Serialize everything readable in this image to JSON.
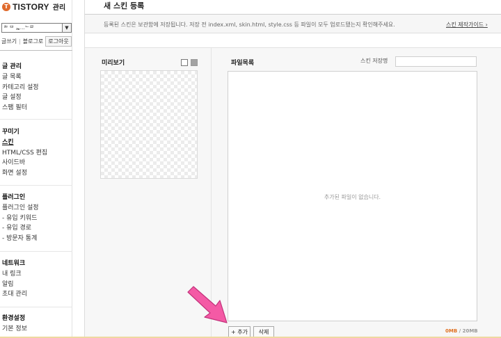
{
  "sidebar": {
    "logo_mark": "T",
    "logo_text": "TISTORY",
    "logo_sub": "관리",
    "blog_select_value": "ᄅᄇ ᄇ ᆲ…ᄂᄅ",
    "top_links": {
      "write": "글쓰기",
      "blog": "블로그로",
      "logout": "로그아웃"
    },
    "groups": [
      {
        "title": "글 관리",
        "items": [
          "글 목록",
          "카테고리 설정",
          "글 설정",
          "스팸 필터"
        ]
      },
      {
        "title": "꾸미기",
        "items": [
          "스킨",
          "HTML/CSS 편집",
          "사이드바",
          "화면 설정"
        ]
      },
      {
        "title": "플러그인",
        "items": [
          "플러그인 설정",
          "- 유입 키워드",
          "- 유입 경로",
          "- 방문자 통계"
        ]
      },
      {
        "title": "네트워크",
        "items": [
          "내 링크",
          "알림",
          "초대 관리"
        ]
      },
      {
        "title": "환경설정",
        "items": [
          "기본 정보"
        ]
      }
    ]
  },
  "header": {
    "title": "새 스킨 등록",
    "notice": "등록된 스킨은 보관함에 저장됩니다. 저장 전 index.xml, skin.html, style.css 등 파일이 모두 업로드됐는지 확인해주세요.",
    "guide_link": "스킨 제작가이드 ›"
  },
  "preview": {
    "label": "미리보기"
  },
  "files": {
    "label": "파일목록",
    "skin_name_label": "스킨 저장명",
    "skin_name_value": "",
    "empty_message": "추가된 파일이 없습니다.",
    "add_button": "+ 추가",
    "delete_button": "삭제",
    "usage_used": "0MB",
    "usage_total": " / 20MB"
  },
  "colors": {
    "logo": "#e06a2c",
    "usage_used": "#e07020",
    "arrow": "#f45aa5"
  }
}
